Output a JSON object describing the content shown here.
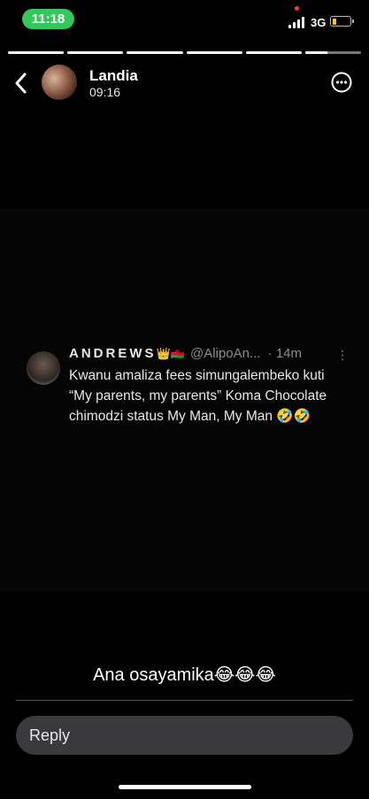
{
  "status_bar": {
    "time": "11:18",
    "network": "3G",
    "battery_level": 0.25,
    "time_pill_color": "#34c759"
  },
  "story": {
    "segments": [
      1,
      1,
      1,
      1,
      1,
      0.4
    ],
    "user_name": "Landia",
    "post_time": "09:16",
    "back_icon": "chevron-left-icon",
    "more_icon": "more-horizontal-icon"
  },
  "tweet": {
    "name": "ANDREWS",
    "name_emoji": "👑🇲🇼",
    "handle": "@AlipoAn...",
    "time": "· 14m",
    "menu": "⋮",
    "text": "Kwanu amaliza fees simungalembeko kuti “My parents, my parents” Koma Chocolate chimodzi status My Man, My Man 🤣🤣"
  },
  "caption": "Ana osayamika😂😂😂",
  "reply": {
    "placeholder": "Reply"
  }
}
